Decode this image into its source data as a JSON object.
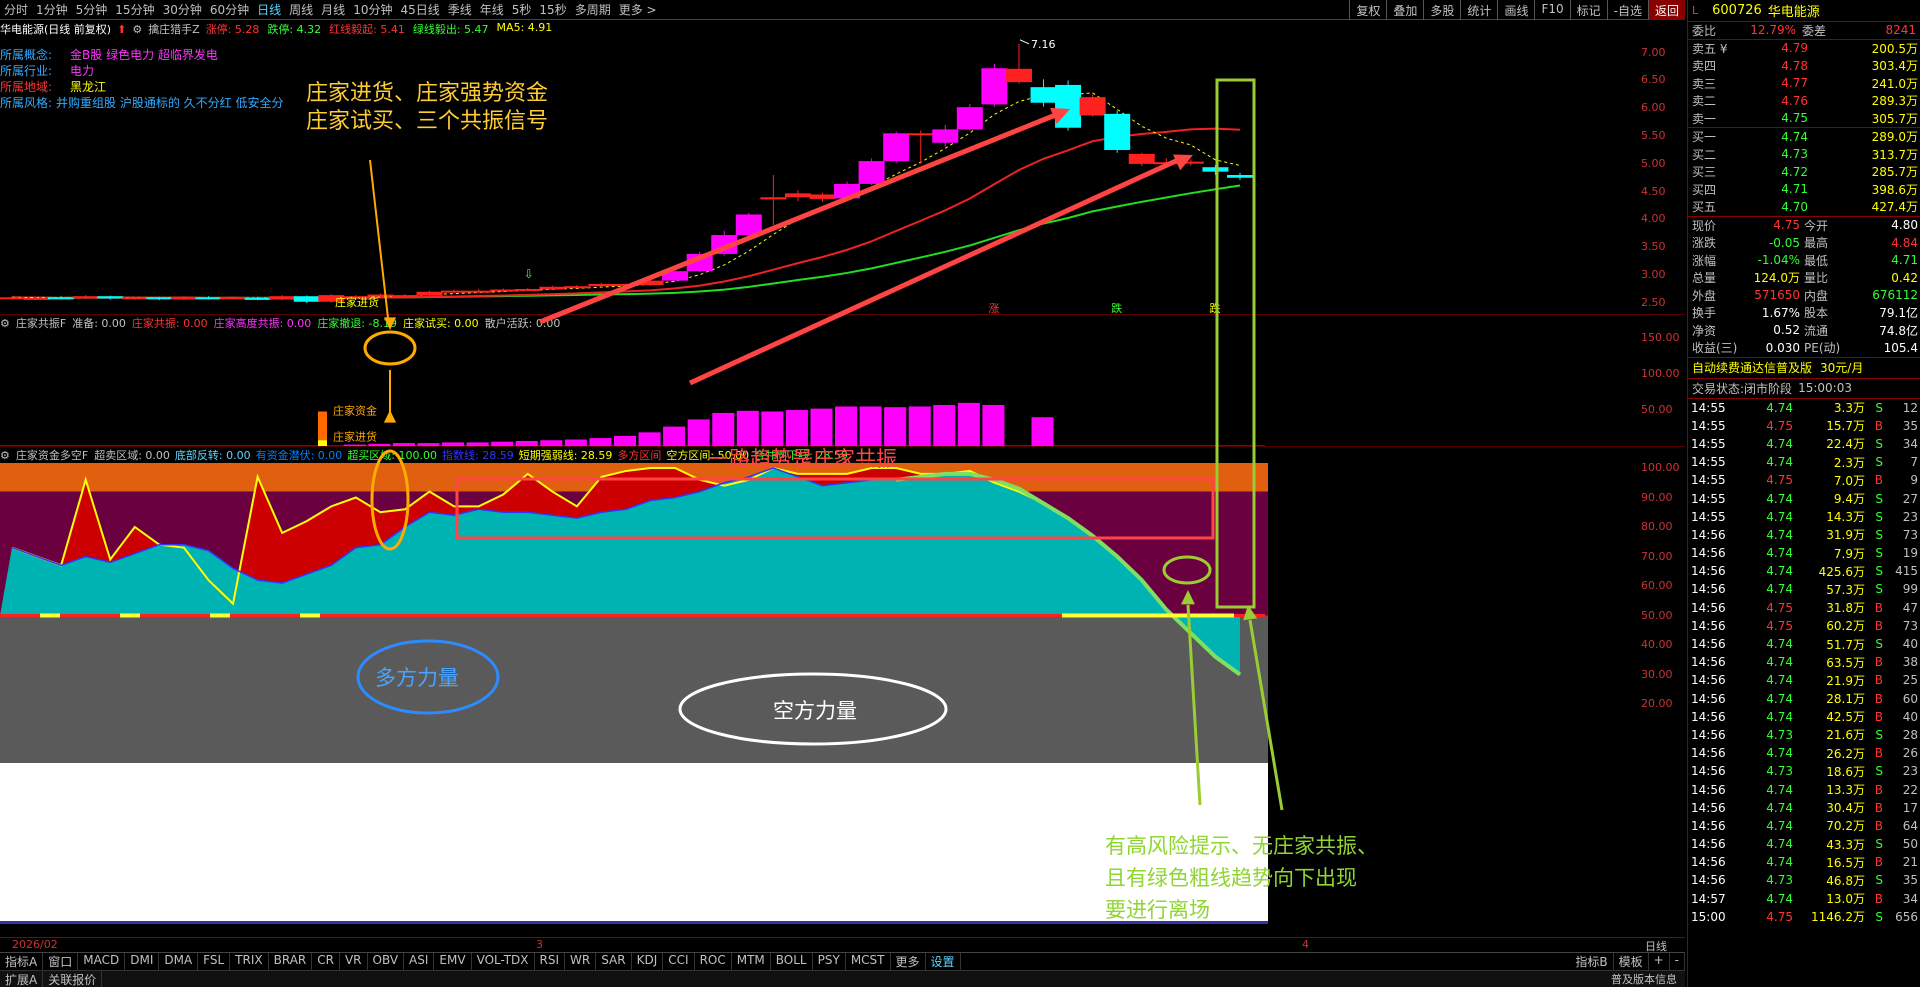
{
  "toolbar": {
    "periods": [
      "分时",
      "1分钟",
      "5分钟",
      "15分钟",
      "30分钟",
      "60分钟",
      "日线",
      "周线",
      "月线",
      "10分钟",
      "45日线",
      "季线",
      "年线",
      "5秒",
      "15秒",
      "多周期",
      "更多 >"
    ],
    "active_index": 6,
    "right_items": [
      "复权",
      "叠加",
      "多股",
      "统计",
      "画线",
      "F10",
      "标记",
      "-自选",
      "返回"
    ]
  },
  "main_panel": {
    "stock_label": "华电能源(日线 前复权)",
    "indicator_name": "擒庄猎手Z",
    "stats": [
      {
        "text": "涨停: 5.28",
        "color": "#ff3333"
      },
      {
        "text": "跌停: 4.32",
        "color": "#33ff33"
      },
      {
        "text": "红线毅起: 5.41",
        "color": "#ff3333"
      },
      {
        "text": "绿线毅出: 5.47",
        "color": "#33ff33"
      },
      {
        "text": "MA5: 4.91",
        "color": "#ffff00"
      }
    ],
    "max_label": "7.16",
    "y_ticks": [
      "7.00",
      "6.50",
      "6.00",
      "5.50",
      "5.00",
      "4.50",
      "4.00",
      "3.50",
      "3.00",
      "2.50"
    ],
    "signals": [
      "涨",
      "跌",
      "跌"
    ],
    "info": [
      {
        "label": "所属概念:",
        "value": "金B股 绿色电力 超临界发电"
      },
      {
        "label": "所属行业:",
        "value": "电力"
      },
      {
        "label": "所属地域:",
        "value": "黑龙江"
      },
      {
        "label": "所属风格:",
        "value": "并购重组股 沪股通标的 久不分红 低安全分"
      }
    ]
  },
  "panel2": {
    "name": "庄家共振F",
    "stats": [
      {
        "text": "准备: 0.00",
        "color": "#c0c0c0"
      },
      {
        "text": "庄家共振: 0.00",
        "color": "#ff3333"
      },
      {
        "text": "庄家高度共振: 0.00",
        "color": "#ff33ff"
      },
      {
        "text": "庄家撤退: -8.19",
        "color": "#33ff33"
      },
      {
        "text": "庄家试买: 0.00",
        "color": "#ffff00"
      },
      {
        "text": "散户活跃: 0.00",
        "color": "#c0c0c0"
      }
    ],
    "y_ticks": [
      "150.00",
      "100.00",
      "50.00"
    ],
    "label_zjzj": "庄家资金",
    "label_zjjh": "庄家进货"
  },
  "panel3": {
    "name": "庄家资金多空F",
    "stats": [
      {
        "text": "超卖区域: 0.00",
        "color": "#c0c0c0"
      },
      {
        "text": "底部反转: 0.00",
        "color": "#5bd5ff"
      },
      {
        "text": "有资金潜伏: 0.00",
        "color": "#0080ff"
      },
      {
        "text": "超买区域: 100.00",
        "color": "#33ff33"
      },
      {
        "text": "指数线: 28.59",
        "color": "#3333ff"
      },
      {
        "text": "短期强弱线: 28.59",
        "color": "#ffff00"
      },
      {
        "text": "多方区间",
        "color": "#ff3333"
      },
      {
        "text": "空方区间: 50.00",
        "color": "#ffff00"
      },
      {
        "text": "合并向下线: 28.59",
        "color": "#33ff33"
      }
    ],
    "y_ticks": [
      "100.00",
      "90.00",
      "80.00",
      "70.00",
      "60.00",
      "50.00",
      "40.00",
      "30.00",
      "20.00"
    ]
  },
  "annotations": {
    "a1_line1": "庄家进货、庄家强势资金",
    "a1_line2": "庄家试买、三个共振信号",
    "a2": "一路趋势是庄家共振",
    "a3": "多方力量",
    "a4": "空方力量",
    "a5_line1": "有高风险提示、无庄家共振、",
    "a5_line2": "且有绿色粗线趋势向下出现",
    "a5_line3": "要进行离场"
  },
  "date_axis": {
    "start": "2026/02",
    "m3": "3",
    "m4": "4",
    "label": "日线"
  },
  "bottom_tabs": [
    "指标A",
    "窗口",
    "MACD",
    "DMI",
    "DMA",
    "FSL",
    "TRIX",
    "BRAR",
    "CR",
    "VR",
    "OBV",
    "ASI",
    "EMV",
    "VOL-TDX",
    "RSI",
    "WR",
    "SAR",
    "KDJ",
    "CCI",
    "ROC",
    "MTM",
    "BOLL",
    "PSY",
    "MCST",
    "更多",
    "设置"
  ],
  "bottom_right": [
    "指标B",
    "模板",
    "+",
    "-"
  ],
  "status_left": [
    "扩展A",
    "关联报价"
  ],
  "status_right": "普及版本信息",
  "quote": {
    "code": "600726",
    "name": "华电能源",
    "wb_label": "委比",
    "wb_value": "12.79%",
    "wc_label": "委差",
    "wc_value": "8241",
    "sell": [
      {
        "label": "卖五 ¥",
        "price": "4.79",
        "vol": "200.5万"
      },
      {
        "label": "卖四",
        "price": "4.78",
        "vol": "303.4万"
      },
      {
        "label": "卖三",
        "price": "4.77",
        "vol": "241.0万"
      },
      {
        "label": "卖二",
        "price": "4.76",
        "vol": "289.3万"
      },
      {
        "label": "卖一",
        "price": "4.75",
        "vol": "305.7万"
      }
    ],
    "buy": [
      {
        "label": "买一",
        "price": "4.74",
        "vol": "289.0万"
      },
      {
        "label": "买二",
        "price": "4.73",
        "vol": "313.7万"
      },
      {
        "label": "买三",
        "price": "4.72",
        "vol": "285.7万"
      },
      {
        "label": "买四",
        "price": "4.71",
        "vol": "398.6万"
      },
      {
        "label": "买五",
        "price": "4.70",
        "vol": "427.4万"
      }
    ],
    "stats": [
      {
        "l1": "现价",
        "v1": "4.75",
        "c1": "#ff3333",
        "l2": "今开",
        "v2": "4.80",
        "c2": "#ffffff"
      },
      {
        "l1": "涨跌",
        "v1": "-0.05",
        "c1": "#33ff33",
        "l2": "最高",
        "v2": "4.84",
        "c2": "#ff3333"
      },
      {
        "l1": "涨幅",
        "v1": "-1.04%",
        "c1": "#33ff33",
        "l2": "最低",
        "v2": "4.71",
        "c2": "#33ff33"
      },
      {
        "l1": "总量",
        "v1": "124.0万",
        "c1": "#ffff00",
        "l2": "量比",
        "v2": "0.42",
        "c2": "#ffff00"
      },
      {
        "l1": "外盘",
        "v1": "571650",
        "c1": "#ff3333",
        "l2": "内盘",
        "v2": "676112",
        "c2": "#33ff33"
      },
      {
        "l1": "换手",
        "v1": "1.67%",
        "c1": "#ffffff",
        "l2": "股本",
        "v2": "79.1亿",
        "c2": "#ffffff"
      },
      {
        "l1": "净资",
        "v1": "0.52",
        "c1": "#ffffff",
        "l2": "流通",
        "v2": "74.8亿",
        "c2": "#ffffff"
      },
      {
        "l1": "收益(三)",
        "v1": "0.030",
        "c1": "#ffffff",
        "l2": "PE(动)",
        "v2": "105.4",
        "c2": "#ffffff"
      }
    ],
    "promo": "自动续费通达信普及版",
    "promo_price": "30元/月",
    "trade_state": "交易状态:",
    "trade_value": "闭市阶段",
    "trade_time": "15:00:03",
    "ticks": [
      [
        "14:55",
        "4.74",
        "3.3万",
        "S",
        "12"
      ],
      [
        "14:55",
        "4.75",
        "15.7万",
        "B",
        "35"
      ],
      [
        "14:55",
        "4.74",
        "22.4万",
        "S",
        "34"
      ],
      [
        "14:55",
        "4.74",
        "2.3万",
        "S",
        "7"
      ],
      [
        "14:55",
        "4.75",
        "7.0万",
        "B",
        "9"
      ],
      [
        "14:55",
        "4.74",
        "9.4万",
        "S",
        "27"
      ],
      [
        "14:55",
        "4.74",
        "14.3万",
        "S",
        "23"
      ],
      [
        "14:56",
        "4.74",
        "31.9万",
        "S",
        "73"
      ],
      [
        "14:56",
        "4.74",
        "7.9万",
        "S",
        "19"
      ],
      [
        "14:56",
        "4.74",
        "425.6万",
        "S",
        "415"
      ],
      [
        "14:56",
        "4.74",
        "57.3万",
        "S",
        "99"
      ],
      [
        "14:56",
        "4.75",
        "31.8万",
        "B",
        "47"
      ],
      [
        "14:56",
        "4.75",
        "60.2万",
        "B",
        "73"
      ],
      [
        "14:56",
        "4.74",
        "51.7万",
        "S",
        "40"
      ],
      [
        "14:56",
        "4.74",
        "63.5万",
        "B",
        "38"
      ],
      [
        "14:56",
        "4.74",
        "21.9万",
        "B",
        "25"
      ],
      [
        "14:56",
        "4.74",
        "28.1万",
        "B",
        "60"
      ],
      [
        "14:56",
        "4.74",
        "42.5万",
        "B",
        "40"
      ],
      [
        "14:56",
        "4.73",
        "21.6万",
        "S",
        "28"
      ],
      [
        "14:56",
        "4.74",
        "26.2万",
        "B",
        "26"
      ],
      [
        "14:56",
        "4.73",
        "18.6万",
        "S",
        "23"
      ],
      [
        "14:56",
        "4.74",
        "13.3万",
        "B",
        "22"
      ],
      [
        "14:56",
        "4.74",
        "30.4万",
        "B",
        "17"
      ],
      [
        "14:56",
        "4.74",
        "70.2万",
        "B",
        "64"
      ],
      [
        "14:56",
        "4.74",
        "43.3万",
        "S",
        "50"
      ],
      [
        "14:56",
        "4.74",
        "16.5万",
        "B",
        "21"
      ],
      [
        "14:56",
        "4.73",
        "46.8万",
        "S",
        "35"
      ],
      [
        "14:57",
        "4.74",
        "13.0万",
        "B",
        "34"
      ],
      [
        "15:00",
        "4.75",
        "1146.2万",
        "S",
        "656"
      ]
    ]
  },
  "chart_data": [
    {
      "type": "candlestick",
      "title": "华电能源(日线 前复权)",
      "ylim": [
        2.3,
        7.3
      ],
      "candles": [
        [
          2.57,
          2.6,
          2.62,
          2.55
        ],
        [
          2.58,
          2.59,
          2.61,
          2.56
        ],
        [
          2.6,
          2.58,
          2.62,
          2.56
        ],
        [
          2.59,
          2.62,
          2.64,
          2.57
        ],
        [
          2.62,
          2.58,
          2.63,
          2.56
        ],
        [
          2.57,
          2.6,
          2.61,
          2.55
        ],
        [
          2.6,
          2.57,
          2.61,
          2.55
        ],
        [
          2.56,
          2.61,
          2.62,
          2.55
        ],
        [
          2.6,
          2.57,
          2.62,
          2.56
        ],
        [
          2.58,
          2.6,
          2.61,
          2.56
        ],
        [
          2.59,
          2.57,
          2.61,
          2.55
        ],
        [
          2.56,
          2.62,
          2.64,
          2.55
        ],
        [
          2.62,
          2.52,
          2.63,
          2.5
        ],
        [
          2.52,
          2.64,
          2.66,
          2.5
        ],
        [
          2.58,
          2.62,
          2.64,
          2.56
        ],
        [
          2.62,
          2.65,
          2.67,
          2.6
        ],
        [
          2.63,
          2.64,
          2.66,
          2.61
        ],
        [
          2.63,
          2.7,
          2.72,
          2.62
        ],
        [
          2.69,
          2.72,
          2.74,
          2.67
        ],
        [
          2.71,
          2.72,
          2.75,
          2.69
        ],
        [
          2.71,
          2.74,
          2.76,
          2.69
        ],
        [
          2.73,
          2.75,
          2.77,
          2.71
        ],
        [
          2.74,
          2.79,
          2.81,
          2.73
        ],
        [
          2.78,
          2.8,
          2.82,
          2.76
        ],
        [
          2.8,
          2.84,
          2.86,
          2.78
        ],
        [
          2.82,
          2.84,
          2.85,
          2.8
        ],
        [
          2.82,
          2.9,
          2.92,
          2.81
        ],
        [
          2.9,
          3.07,
          3.09,
          2.89
        ],
        [
          3.07,
          3.38,
          3.42,
          3.05
        ],
        [
          3.38,
          3.72,
          3.8,
          3.35
        ],
        [
          3.72,
          4.09,
          4.12,
          3.7
        ],
        [
          4.36,
          4.4,
          4.8,
          3.9
        ],
        [
          4.4,
          4.47,
          4.53,
          4.33
        ],
        [
          4.45,
          4.37,
          4.48,
          4.32
        ],
        [
          4.38,
          4.64,
          4.68,
          4.35
        ],
        [
          4.64,
          5.05,
          5.1,
          4.62
        ],
        [
          5.05,
          5.55,
          5.58,
          5.02
        ],
        [
          5.55,
          5.54,
          5.6,
          5.0
        ],
        [
          5.38,
          5.62,
          5.7,
          5.31
        ],
        [
          5.62,
          6.02,
          6.08,
          5.6
        ],
        [
          6.07,
          6.72,
          6.8,
          6.03
        ],
        [
          6.47,
          6.71,
          7.16,
          6.44
        ],
        [
          6.38,
          6.1,
          6.52,
          6.03
        ],
        [
          6.42,
          5.65,
          6.5,
          5.6
        ],
        [
          5.87,
          6.2,
          6.25,
          5.85
        ],
        [
          5.9,
          5.25,
          5.96,
          5.2
        ],
        [
          5.0,
          5.18,
          5.2,
          4.96
        ],
        [
          5.03,
          5.03,
          5.1,
          4.93
        ],
        [
          5.03,
          5.04,
          5.08,
          4.97
        ],
        [
          4.94,
          4.86,
          4.98,
          4.8
        ],
        [
          4.8,
          4.75,
          4.84,
          4.71
        ]
      ]
    },
    {
      "type": "bar",
      "title": "庄家共振F",
      "ylim": [
        0,
        160
      ],
      "values": [
        0,
        0,
        0,
        0,
        0,
        0,
        0,
        0,
        0,
        0,
        0,
        0,
        0,
        2,
        3,
        4,
        4,
        5,
        5,
        6,
        7,
        8,
        9,
        11,
        14,
        19,
        27,
        37,
        46,
        49,
        48,
        50,
        52,
        55,
        55,
        54,
        55,
        57,
        60,
        57,
        0,
        40,
        0,
        0,
        0,
        -2,
        -3,
        -5,
        -7
      ],
      "labels": [
        "庄家资金",
        "庄家进货"
      ]
    },
    {
      "type": "area",
      "title": "庄家资金多空F",
      "ylim": [
        0,
        100
      ],
      "series": [
        {
          "name": "指数线",
          "values": [
            73,
            70,
            67,
            70,
            68,
            71,
            74,
            74,
            72,
            66,
            62,
            61,
            64,
            67,
            73,
            74,
            80,
            85,
            84,
            86,
            85,
            85,
            84,
            83,
            85,
            86,
            89,
            90,
            92,
            95,
            97,
            100,
            97,
            94,
            95,
            96,
            96,
            97,
            98,
            98,
            96,
            93,
            88,
            83,
            77,
            70,
            62,
            52,
            44,
            36,
            30
          ]
        },
        {
          "name": "短期强弱线",
          "values": [
            73,
            70,
            67,
            96,
            69,
            80,
            74,
            73,
            62,
            54,
            97,
            78,
            82,
            87,
            90,
            85,
            86,
            92,
            87,
            87,
            91,
            98,
            92,
            87,
            97,
            99,
            100,
            100,
            96,
            94,
            96,
            100,
            98,
            98,
            98,
            100,
            100,
            98,
            98,
            99,
            95,
            92,
            88,
            83,
            77,
            70,
            62,
            52,
            44,
            36,
            30
          ]
        }
      ]
    }
  ]
}
